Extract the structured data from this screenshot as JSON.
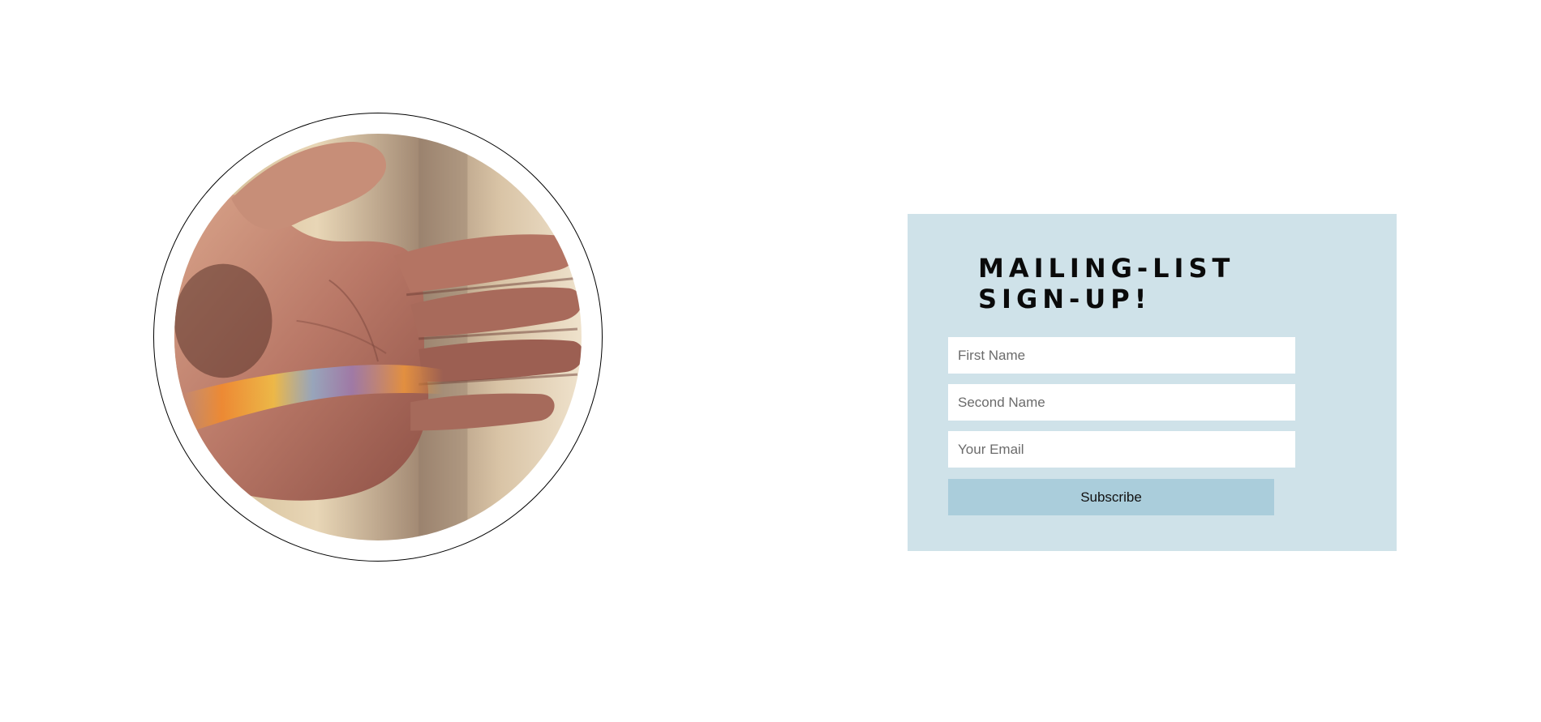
{
  "hero": {
    "image_subject": "open-palm-with-rainbow-light"
  },
  "signup": {
    "title": "Mailing-List Sign-Up!",
    "first_name_placeholder": "First Name",
    "second_name_placeholder": "Second Name",
    "email_placeholder": "Your Email",
    "subscribe_label": "Subscribe"
  },
  "colors": {
    "panel_background": "#cfe2e9",
    "button_background": "#aacddb",
    "page_background": "#ffffff"
  }
}
